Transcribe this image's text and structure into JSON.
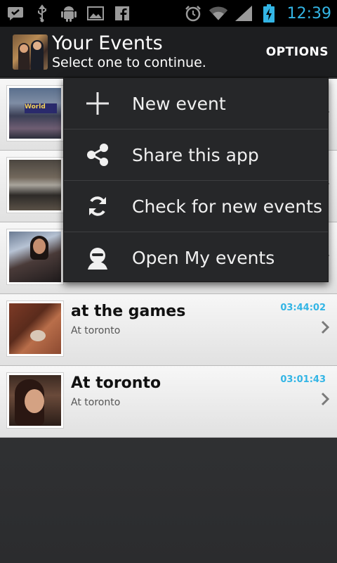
{
  "status_bar": {
    "time": "12:39",
    "left_icons": [
      "check-notification-icon",
      "usb-icon",
      "android-icon",
      "image-icon",
      "facebook-icon"
    ],
    "right_icons": [
      "alarm-icon",
      "wifi-icon",
      "signal-icon",
      "battery-charging-icon"
    ]
  },
  "action_bar": {
    "title": "Your Events",
    "subtitle": "Select one to continue.",
    "options_label": "OPTIONS"
  },
  "events": [
    {
      "title": "",
      "subtitle": "",
      "time": "",
      "thumb": "crowd-outdoor-world"
    },
    {
      "title": "",
      "subtitle": "",
      "time": "",
      "thumb": "venue-hall"
    },
    {
      "title": "",
      "subtitle": "",
      "time": "",
      "thumb": "woman-seated"
    },
    {
      "title": "at the games",
      "subtitle": "At toronto",
      "time": "03:44:02",
      "thumb": "floor-object"
    },
    {
      "title": "At toronto",
      "subtitle": "At toronto",
      "time": "03:01:43",
      "thumb": "woman-portrait"
    }
  ],
  "menu": {
    "items": [
      {
        "label": "New event",
        "icon": "plus-icon"
      },
      {
        "label": "Share this app",
        "icon": "share-icon"
      },
      {
        "label": "Check for new events",
        "icon": "refresh-icon"
      },
      {
        "label": "Open My events",
        "icon": "person-icon"
      }
    ]
  },
  "colors": {
    "accent": "#33b5e5",
    "action_bar": "#1d1e20",
    "menu_bg": "#262729"
  }
}
